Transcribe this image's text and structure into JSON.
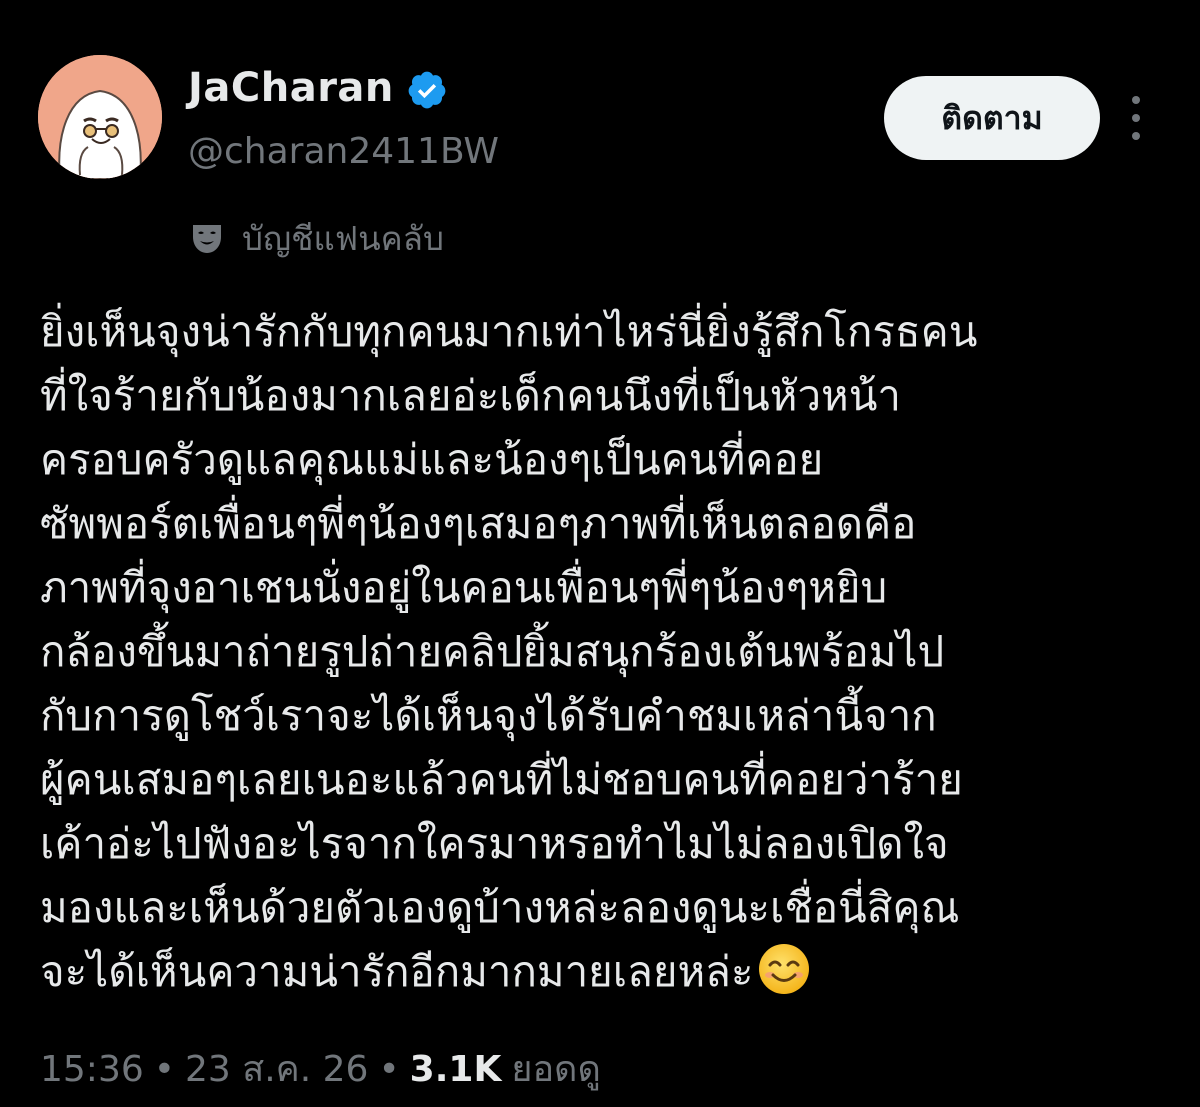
{
  "author": {
    "display_name": "JaCharan",
    "handle": "@charan2411BW",
    "verified": true,
    "avatar_icon": "ghost-character-avatar"
  },
  "actions": {
    "follow_label": "ติดตาม",
    "more_icon": "more-dots-icon"
  },
  "community": {
    "icon": "theater-mask-icon",
    "label": "บัญชีแฟนคลับ"
  },
  "body": {
    "lines": [
      "ยิ่งเห็นจุงน่ารักกับทุกคนมากเท่าไหร่นี่ยิ่งรู้สึกโกรธคน",
      "ที่ใจร้ายกับน้องมากเลยอ่ะเด็กคนนึงที่เป็นหัวหน้า",
      "ครอบครัวดูแลคุณแม่และน้องๆเป็นคนที่คอย",
      "ซัพพอร์ตเพื่อนๆพี่ๆน้องๆเสมอๆภาพที่เห็นตลอดคือ",
      "ภาพที่จุงอาเชนนั่งอยู่ในคอนเพื่อนๆพี่ๆน้องๆหยิบ",
      "กล้องขึ้นมาถ่ายรูปถ่ายคลิปยิ้มสนุกร้องเต้นพร้อมไป",
      "กับการดูโชว์เราจะได้เห็นจุงได้รับคำชมเหล่านี้จาก",
      "ผู้คนเสมอๆเลยเนอะแล้วคนที่ไม่ชอบคนที่คอยว่าร้าย",
      "เค้าอ่ะไปฟังอะไรจากใครมาหรอทำไมไม่ลองเปิดใจ",
      "มองและเห็นด้วยตัวเองดูบ้างหล่ะลองดูนะเชื่อนี่สิคุณ",
      "จะได้เห็นความน่ารักอีกมากมายเลยหล่ะ"
    ],
    "trailing_emoji": "smiling-face-emoji"
  },
  "meta": {
    "time": "15:36",
    "separator": "•",
    "date": "23 ส.ค. 26",
    "views_count": "3.1K",
    "views_label": "ยอดดู"
  },
  "colors": {
    "background": "#000000",
    "primary_text": "#e7e9ea",
    "secondary_text": "#71767b",
    "verified_blue": "#1d9bf0",
    "follow_button_bg": "#eff3f4"
  }
}
